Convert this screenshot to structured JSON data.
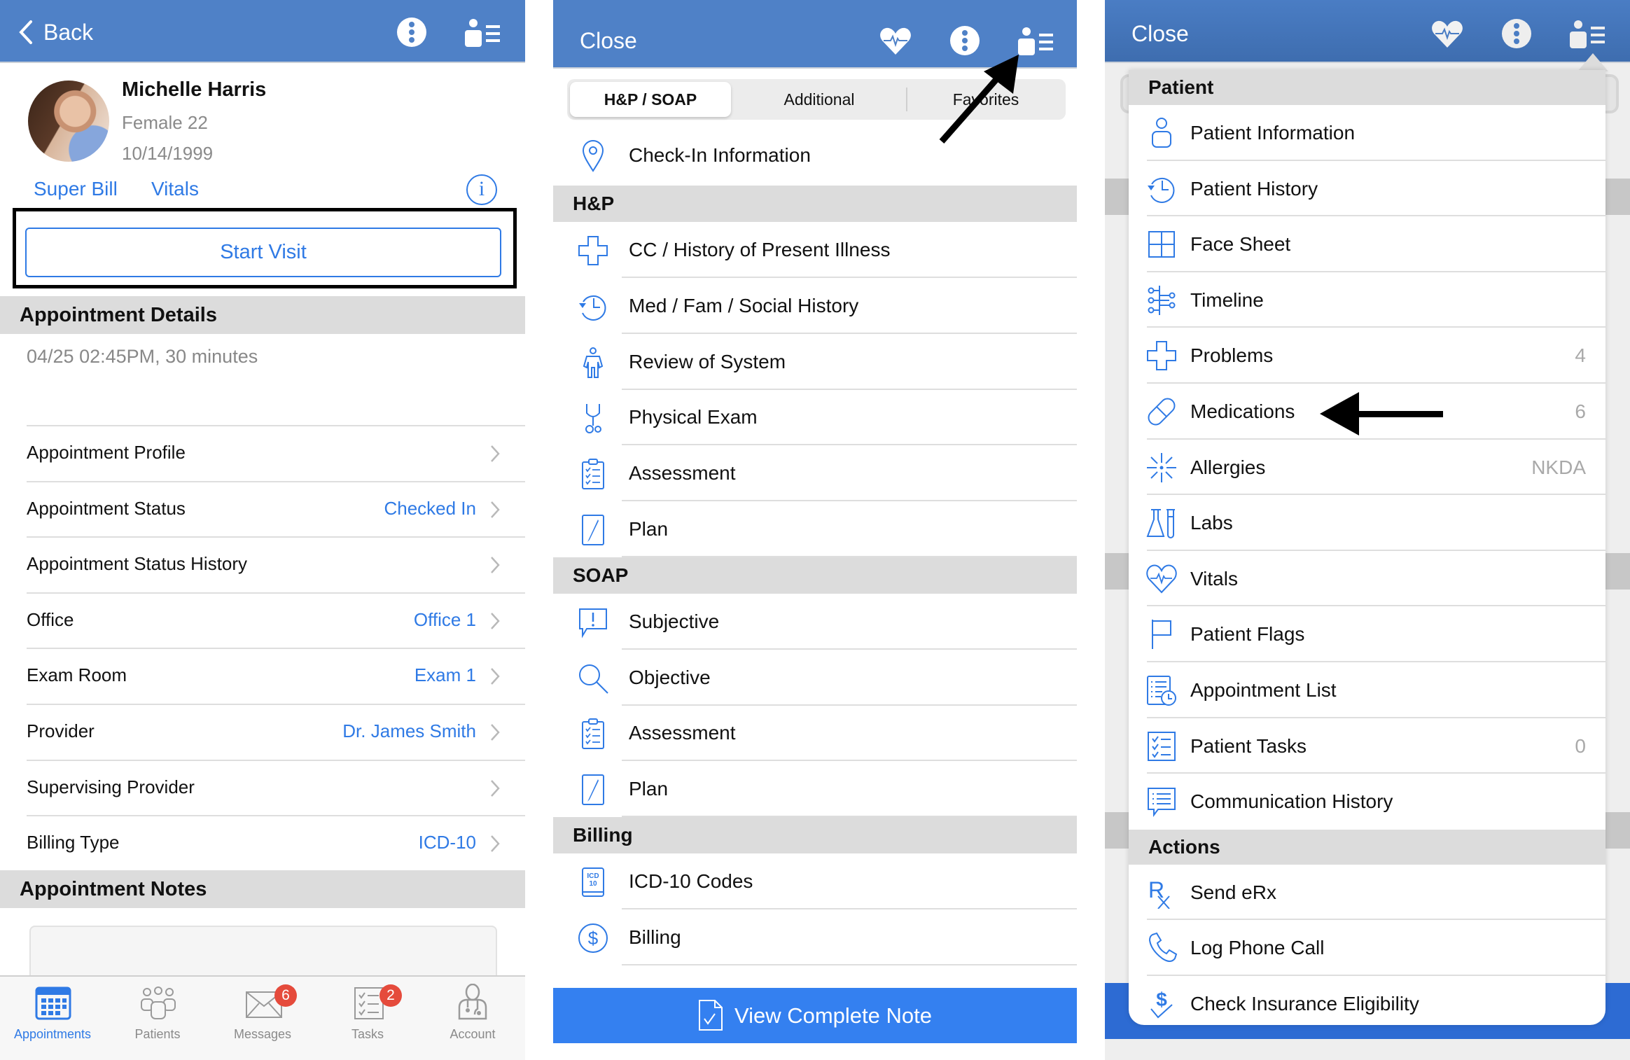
{
  "theme": {
    "header_blue": "#4f81c7",
    "link_blue": "#2f7ae5",
    "badge_red": "#e54b3c",
    "button_blue": "#3480f0"
  },
  "panel1": {
    "header": {
      "back_label": "Back",
      "icons": [
        "more-icon",
        "patient-menu-icon"
      ]
    },
    "patient": {
      "name": "Michelle Harris",
      "gender_age": "Female 22",
      "dob": "10/14/1999"
    },
    "links": {
      "super_bill": "Super Bill",
      "vitals": "Vitals",
      "info_icon": "i"
    },
    "start_visit_label": "Start Visit",
    "appointment_details": {
      "title": "Appointment Details",
      "datetime": "04/25 02:45PM, 30 minutes",
      "rows": [
        {
          "label": "Appointment Profile",
          "value": ""
        },
        {
          "label": "Appointment Status",
          "value": "Checked In"
        },
        {
          "label": "Appointment Status History",
          "value": ""
        },
        {
          "label": "Office",
          "value": "Office 1"
        },
        {
          "label": "Exam Room",
          "value": "Exam 1"
        },
        {
          "label": "Provider",
          "value": "Dr. James Smith"
        },
        {
          "label": "Supervising Provider",
          "value": ""
        },
        {
          "label": "Billing Type",
          "value": "ICD-10"
        }
      ]
    },
    "appointment_notes": {
      "title": "Appointment Notes",
      "value": ""
    },
    "tabbar": [
      {
        "label": "Appointments",
        "icon": "calendar-icon",
        "active": true,
        "badge": ""
      },
      {
        "label": "Patients",
        "icon": "patients-icon",
        "active": false,
        "badge": ""
      },
      {
        "label": "Messages",
        "icon": "envelope-icon",
        "active": false,
        "badge": "6"
      },
      {
        "label": "Tasks",
        "icon": "tasks-icon",
        "active": false,
        "badge": "2"
      },
      {
        "label": "Account",
        "icon": "doctor-icon",
        "active": false,
        "badge": ""
      }
    ]
  },
  "panel2": {
    "header": {
      "close_label": "Close",
      "icons": [
        "vitals-heart-icon",
        "more-icon",
        "patient-menu-icon"
      ]
    },
    "segments": [
      {
        "label": "H&P / SOAP",
        "active": true
      },
      {
        "label": "Additional",
        "active": false
      },
      {
        "label": "Favorites",
        "active": false
      }
    ],
    "checkin_label": "Check-In Information",
    "sections": [
      {
        "title": "H&P",
        "items": [
          {
            "label": "CC / History of Present Illness",
            "icon": "medical-cross-icon"
          },
          {
            "label": "Med / Fam / Social History",
            "icon": "history-clock-icon"
          },
          {
            "label": "Review of System",
            "icon": "body-icon"
          },
          {
            "label": "Physical Exam",
            "icon": "stethoscope-icon"
          },
          {
            "label": "Assessment",
            "icon": "clipboard-icon"
          },
          {
            "label": "Plan",
            "icon": "pen-icon"
          }
        ]
      },
      {
        "title": "SOAP",
        "items": [
          {
            "label": "Subjective",
            "icon": "speech-exclamation-icon"
          },
          {
            "label": "Objective",
            "icon": "magnifier-icon"
          },
          {
            "label": "Assessment",
            "icon": "clipboard-icon"
          },
          {
            "label": "Plan",
            "icon": "pen-icon"
          }
        ]
      },
      {
        "title": "Billing",
        "items": [
          {
            "label": "ICD-10 Codes",
            "icon": "icd10-book-icon",
            "icon_text_1": "ICD",
            "icon_text_2": "10"
          },
          {
            "label": "Billing",
            "icon": "dollar-circle-icon"
          }
        ]
      }
    ],
    "view_note_label": "View Complete Note"
  },
  "panel3": {
    "header": {
      "close_label": "Close",
      "icons": [
        "vitals-heart-icon",
        "more-icon",
        "patient-menu-icon"
      ]
    },
    "popover": {
      "patient_section": "Patient",
      "patient_items": [
        {
          "label": "Patient Information",
          "icon": "person-icon",
          "count": ""
        },
        {
          "label": "Patient History",
          "icon": "history-clock-icon",
          "count": ""
        },
        {
          "label": "Face Sheet",
          "icon": "grid-icon",
          "count": ""
        },
        {
          "label": "Timeline",
          "icon": "timeline-icon",
          "count": ""
        },
        {
          "label": "Problems",
          "icon": "medical-cross-icon",
          "count": "4"
        },
        {
          "label": "Medications",
          "icon": "pill-icon",
          "count": "6"
        },
        {
          "label": "Allergies",
          "icon": "allergy-burst-icon",
          "count": "NKDA"
        },
        {
          "label": "Labs",
          "icon": "flask-icon",
          "count": ""
        },
        {
          "label": "Vitals",
          "icon": "heart-pulse-icon",
          "count": ""
        },
        {
          "label": "Patient Flags",
          "icon": "flag-icon",
          "count": ""
        },
        {
          "label": "Appointment List",
          "icon": "appointment-list-icon",
          "count": ""
        },
        {
          "label": "Patient Tasks",
          "icon": "checklist-icon",
          "count": "0"
        },
        {
          "label": "Communication History",
          "icon": "chat-list-icon",
          "count": ""
        }
      ],
      "actions_section": "Actions",
      "action_items": [
        {
          "label": "Send eRx",
          "icon": "rx-icon"
        },
        {
          "label": "Log Phone Call",
          "icon": "phone-icon"
        },
        {
          "label": "Check Insurance Eligibility",
          "icon": "dollar-check-icon"
        }
      ]
    }
  }
}
